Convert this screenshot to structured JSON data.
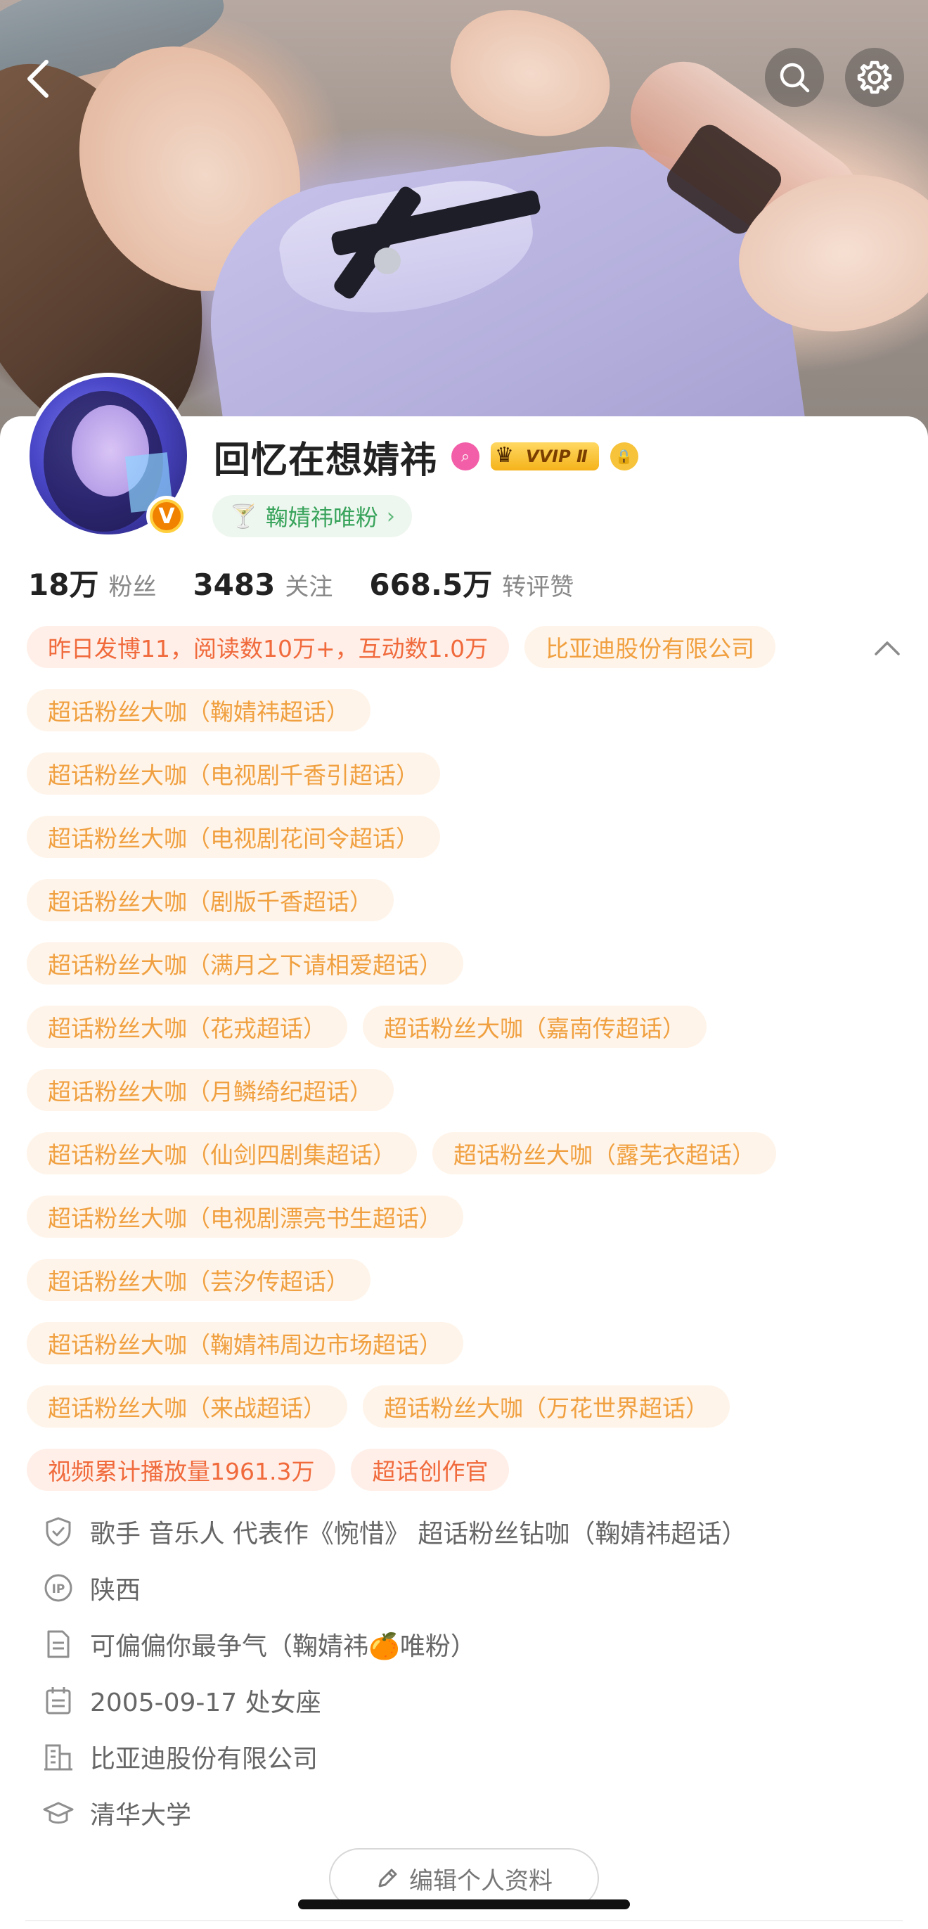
{
  "profile": {
    "name": "回忆在想婧祎",
    "vvip_label": "VVIP Ⅱ",
    "fan_chip_label": "鞠婧祎唯粉",
    "v_badge": "V"
  },
  "stats": [
    {
      "num": "18万",
      "label": "粉丝"
    },
    {
      "num": "3483",
      "label": "关注"
    },
    {
      "num": "668.5万",
      "label": "转评赞"
    }
  ],
  "tags": {
    "row1": [
      "昨日发博11，阅读数10万+，互动数1.0万",
      "比亚迪股份有限公司"
    ],
    "rows": [
      [
        "超话粉丝大咖（鞠婧祎超话）"
      ],
      [
        "超话粉丝大咖（电视剧千香引超话）"
      ],
      [
        "超话粉丝大咖（电视剧花间令超话）"
      ],
      [
        "超话粉丝大咖（剧版千香超话）"
      ],
      [
        "超话粉丝大咖（满月之下请相爱超话）"
      ],
      [
        "超话粉丝大咖（花戎超话）",
        "超话粉丝大咖（嘉南传超话）"
      ],
      [
        "超话粉丝大咖（月鳞绮纪超话）"
      ],
      [
        "超话粉丝大咖（仙剑四剧集超话）",
        "超话粉丝大咖（露芜衣超话）"
      ],
      [
        "超话粉丝大咖（电视剧漂亮书生超话）"
      ],
      [
        "超话粉丝大咖（芸汐传超话）"
      ],
      [
        "超话粉丝大咖（鞠婧祎周边市场超话）"
      ],
      [
        "超话粉丝大咖（来战超话）",
        "超话粉丝大咖（万花世界超话）"
      ]
    ],
    "last_row": [
      "视频累计播放量1961.3万",
      "超话创作官"
    ]
  },
  "info": {
    "verified": "歌手 音乐人 代表作《惋惜》 超话粉丝钻咖（鞠婧祎超话）",
    "ip": "陕西",
    "bio": "可偏偏你最争气（鞠婧祎🍊唯粉）",
    "birthday": "2005-09-17 处女座",
    "company": "比亚迪股份有限公司",
    "school": "清华大学"
  },
  "edit_button": "编辑个人资料",
  "icons": [
    "back-icon",
    "search-icon",
    "gear-icon",
    "collapse-chevron-icon",
    "shield-icon",
    "ip-icon",
    "document-icon",
    "calendar-icon",
    "building-icon",
    "graduation-cap-icon",
    "pencil-icon"
  ],
  "colors": {
    "tag_bg": "#fff4e9",
    "tag_text": "#f0a040",
    "tag_red_text": "#f06a3c",
    "fan_chip_text": "#38a35b",
    "vvip": "#f5b31b"
  }
}
